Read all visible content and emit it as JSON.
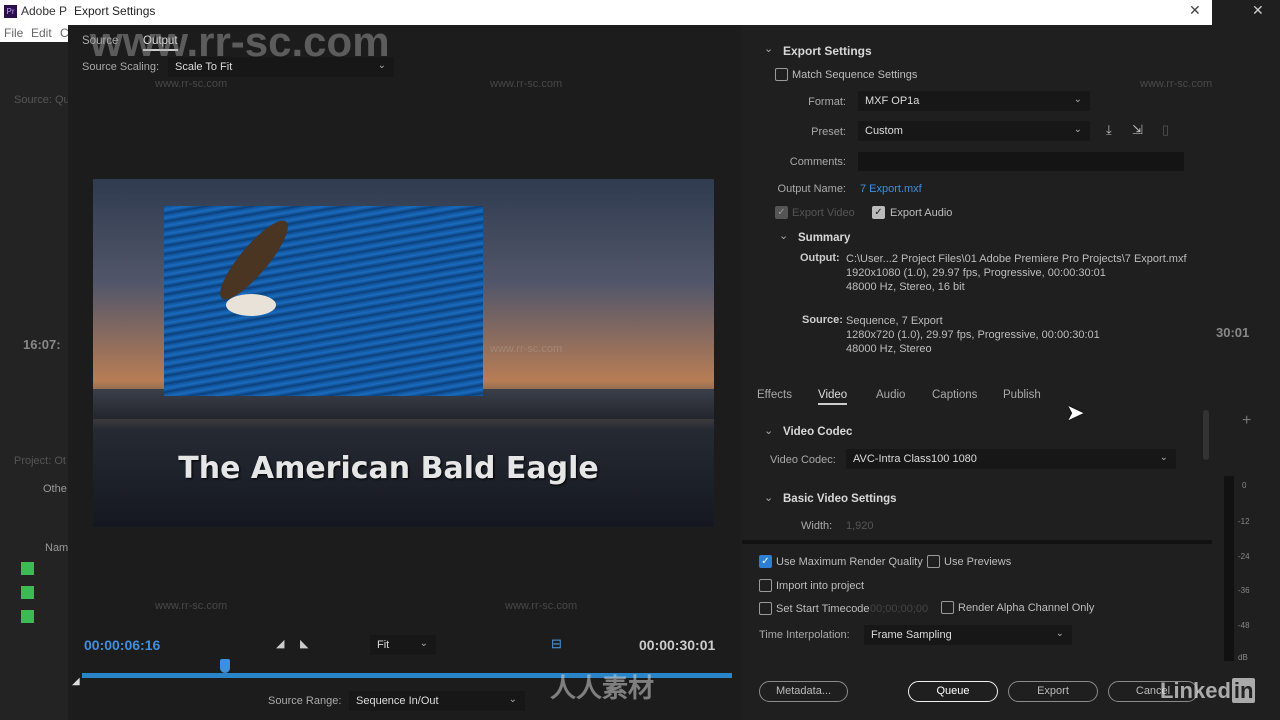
{
  "app": {
    "title": "Adobe P",
    "menu": [
      "File",
      "Edit",
      "C"
    ],
    "panels": {
      "source": "Source: Qu",
      "project": "Project: Ot",
      "other": "Othe",
      "name_col": "Nam",
      "timecode_left": "16:07:",
      "timecode_right": "30:01"
    },
    "meter_ticks": [
      "0",
      "-12",
      "-24",
      "-36",
      "-48",
      "dB"
    ]
  },
  "dialog": {
    "title": "Export Settings",
    "source_tabs": [
      {
        "label": "Source",
        "active": false
      },
      {
        "label": "Output",
        "active": true
      }
    ],
    "source_scaling": {
      "label": "Source Scaling:",
      "value": "Scale To Fit"
    },
    "preview": {
      "title_text": "The American Bald Eagle"
    },
    "timeline": {
      "current_time": "00:00:06:16",
      "duration": "00:00:30:01",
      "zoom": "Fit",
      "playhead_fraction": 0.22,
      "source_range_label": "Source Range:",
      "source_range": "Sequence In/Out"
    },
    "export_settings": {
      "header": "Export Settings",
      "match_sequence": {
        "label": "Match Sequence Settings",
        "checked": false
      },
      "format": {
        "label": "Format:",
        "value": "MXF OP1a"
      },
      "preset": {
        "label": "Preset:",
        "value": "Custom"
      },
      "comments": {
        "label": "Comments:",
        "value": ""
      },
      "output_name": {
        "label": "Output Name:",
        "value": "7 Export.mxf"
      },
      "export_video": {
        "label": "Export Video",
        "checked": true,
        "disabled": true
      },
      "export_audio": {
        "label": "Export Audio",
        "checked": true
      },
      "summary": {
        "header": "Summary",
        "output_label": "Output:",
        "output_lines": [
          "C:\\User...2 Project Files\\01 Adobe Premiere Pro Projects\\7 Export.mxf",
          "1920x1080 (1.0), 29.97 fps, Progressive, 00:00:30:01",
          "48000 Hz, Stereo, 16 bit"
        ],
        "source_label": "Source:",
        "source_lines": [
          "Sequence, 7 Export",
          "1280x720 (1.0), 29.97 fps, Progressive, 00:00:30:01",
          "48000 Hz, Stereo"
        ]
      }
    },
    "settings_tabs": [
      {
        "label": "Effects",
        "active": false
      },
      {
        "label": "Video",
        "active": true
      },
      {
        "label": "Audio",
        "active": false
      },
      {
        "label": "Captions",
        "active": false
      },
      {
        "label": "Publish",
        "active": false
      }
    ],
    "video_codec": {
      "header": "Video Codec",
      "label": "Video Codec:",
      "value": "AVC-Intra Class100 1080"
    },
    "basic_video": {
      "header": "Basic Video Settings",
      "width_label": "Width:",
      "width_value": "1,920"
    },
    "options": {
      "max_render": {
        "label": "Use Maximum Render Quality",
        "checked": true
      },
      "previews": {
        "label": "Use Previews",
        "checked": false
      },
      "import": {
        "label": "Import into project",
        "checked": false
      },
      "start_tc": {
        "label": "Set Start Timecode",
        "value": "00;00;00;00",
        "checked": false
      },
      "alpha": {
        "label": "Render Alpha Channel Only",
        "checked": false
      }
    },
    "time_interp": {
      "label": "Time Interpolation:",
      "value": "Frame Sampling"
    },
    "buttons": {
      "metadata": "Metadata...",
      "queue": "Queue",
      "export": "Export",
      "cancel": "Cancel"
    }
  },
  "watermark": {
    "big": "www.rr-sc.com",
    "small": "www.rr-sc.com",
    "cn": "人 人 素 材",
    "logo": "人人素材",
    "linkedin": "Linked"
  }
}
